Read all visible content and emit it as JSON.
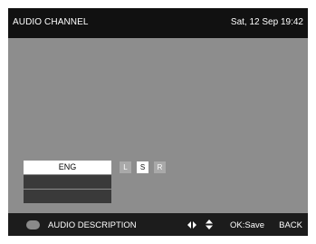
{
  "header": {
    "title": "AUDIO CHANNEL",
    "clock": "Sat, 12 Sep 19:42"
  },
  "audio_list": {
    "items": [
      {
        "label": "ENG",
        "selected": true
      },
      {
        "label": "",
        "selected": false
      },
      {
        "label": "",
        "selected": false
      }
    ]
  },
  "channels": [
    {
      "label": "L",
      "active": false
    },
    {
      "label": "S",
      "active": true
    },
    {
      "label": "R",
      "active": false
    }
  ],
  "footer": {
    "color_key": "grey",
    "audio_description": "AUDIO DESCRIPTION",
    "nav_icons": [
      "left-right-arrows-icon",
      "up-down-arrows-icon"
    ],
    "ok_save": "OK:Save",
    "back": "BACK"
  },
  "colors": {
    "background": "#8d8d8d",
    "header": "#111111",
    "footer": "#1c1c1c",
    "selected_item": "#ffffff",
    "list_item": "#3a3a3a",
    "channel_inactive": "#a9a9a9"
  }
}
